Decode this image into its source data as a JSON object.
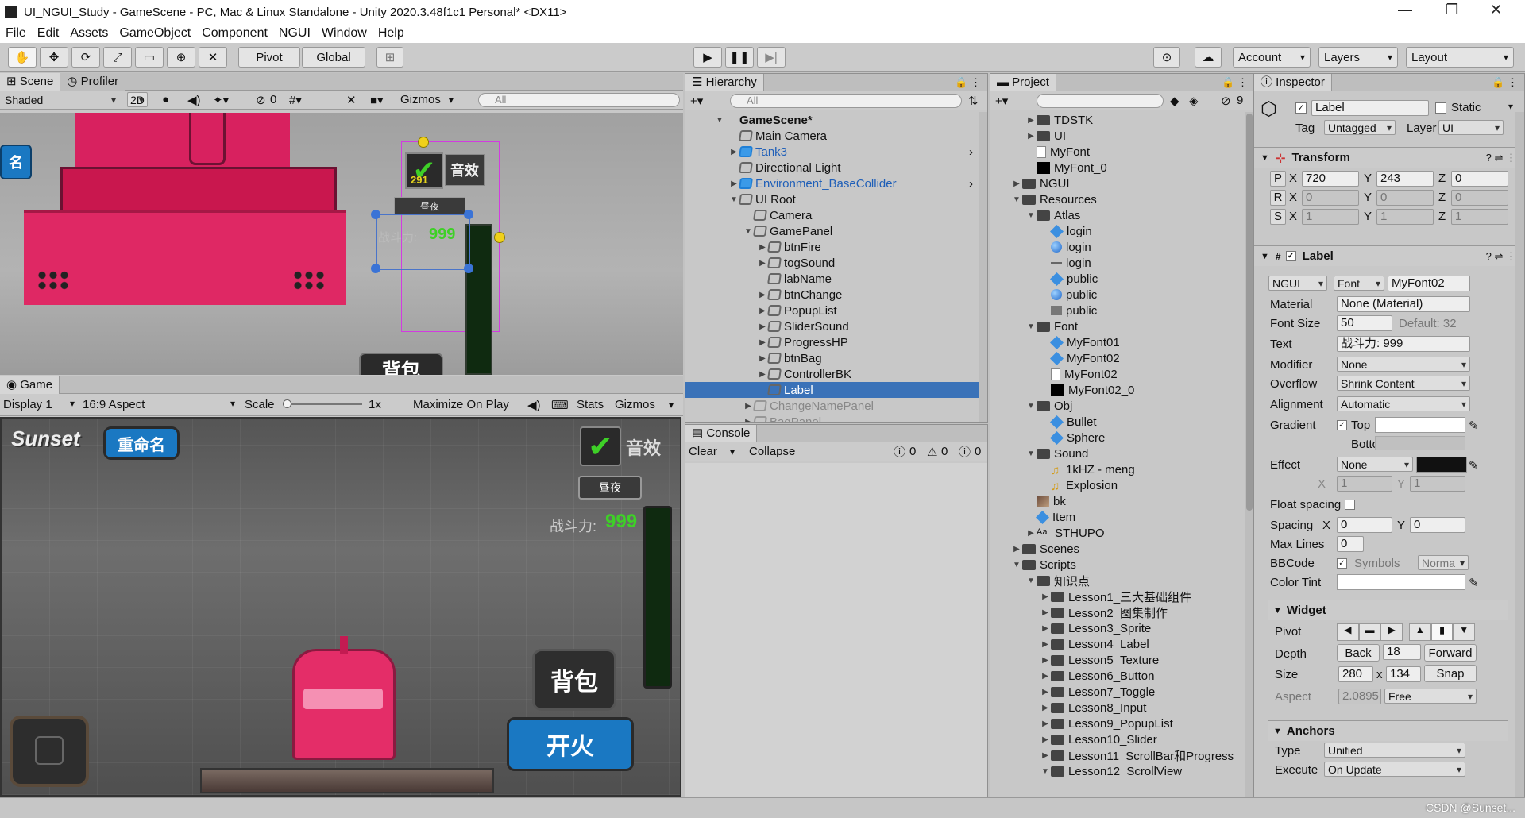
{
  "window": {
    "title": "UI_NGUI_Study - GameScene - PC, Mac & Linux Standalone - Unity 2020.3.48f1c1 Personal* <DX11>",
    "minimize": "—",
    "restore": "❐",
    "close": "✕"
  },
  "menu": [
    "File",
    "Edit",
    "Assets",
    "GameObject",
    "Component",
    "NGUI",
    "Window",
    "Help"
  ],
  "toolbar": {
    "pivot": "Pivot",
    "global": "Global",
    "account": "Account",
    "layers": "Layers",
    "layout": "Layout"
  },
  "scene": {
    "tab": "Scene",
    "profiler_tab": "Profiler",
    "shading": "Shaded",
    "mode2d": "2D",
    "hidden_count": "0",
    "gizmos": "Gizmos",
    "search_placeholder": "All",
    "label_rename": "名",
    "label_sound": "音效",
    "label_daynight": "昼夜",
    "label_power": "战斗力:",
    "power_value": "999",
    "number": "291",
    "label_bag": "背包"
  },
  "game": {
    "tab": "Game",
    "display": "Display 1",
    "aspect": "16:9 Aspect",
    "scale_label": "Scale",
    "scale_value": "1x",
    "maximize": "Maximize On Play",
    "stats": "Stats",
    "gizmos": "Gizmos",
    "logo": "Sunset",
    "rename": "重命名",
    "sound": "音效",
    "daynight": "昼夜",
    "power_label": "战斗力:",
    "power_value": "999",
    "bag": "背包",
    "fire": "开火"
  },
  "hierarchy": {
    "tab": "Hierarchy",
    "search_placeholder": "All",
    "items": [
      {
        "label": "GameScene*",
        "depth": 0,
        "bold": true,
        "arrow": "▼"
      },
      {
        "label": "Main Camera",
        "depth": 1,
        "arrow": ""
      },
      {
        "label": "Tank3",
        "depth": 1,
        "arrow": "▶",
        "blue": true
      },
      {
        "label": "Directional Light",
        "depth": 1,
        "arrow": ""
      },
      {
        "label": "Environment_BaseCollider",
        "depth": 1,
        "arrow": "▶",
        "blue": true
      },
      {
        "label": "UI Root",
        "depth": 1,
        "arrow": "▼"
      },
      {
        "label": "Camera",
        "depth": 2,
        "arrow": ""
      },
      {
        "label": "GamePanel",
        "depth": 2,
        "arrow": "▼"
      },
      {
        "label": "btnFire",
        "depth": 3,
        "arrow": "▶"
      },
      {
        "label": "togSound",
        "depth": 3,
        "arrow": "▶"
      },
      {
        "label": "labName",
        "depth": 3,
        "arrow": ""
      },
      {
        "label": "btnChange",
        "depth": 3,
        "arrow": "▶"
      },
      {
        "label": "PopupList",
        "depth": 3,
        "arrow": "▶"
      },
      {
        "label": "SliderSound",
        "depth": 3,
        "arrow": "▶"
      },
      {
        "label": "ProgressHP",
        "depth": 3,
        "arrow": "▶"
      },
      {
        "label": "btnBag",
        "depth": 3,
        "arrow": "▶"
      },
      {
        "label": "ControllerBK",
        "depth": 3,
        "arrow": "▶"
      },
      {
        "label": "Label",
        "depth": 3,
        "arrow": "",
        "selected": true
      },
      {
        "label": "ChangeNamePanel",
        "depth": 2,
        "arrow": "▶",
        "dim": true
      },
      {
        "label": "BagPanel",
        "depth": 2,
        "arrow": "▶",
        "dim": true
      }
    ]
  },
  "console": {
    "tab": "Console",
    "clear": "Clear",
    "collapse": "Collapse",
    "info": "0",
    "warn": "0",
    "error": "0"
  },
  "project": {
    "tab": "Project",
    "hidden_count": "9",
    "items": [
      {
        "label": "TDSTK",
        "depth": 2,
        "type": "folder",
        "arrow": "▶"
      },
      {
        "label": "UI",
        "depth": 2,
        "type": "folder",
        "arrow": "▶"
      },
      {
        "label": "MyFont",
        "depth": 2,
        "type": "file",
        "arrow": ""
      },
      {
        "label": "MyFont_0",
        "depth": 2,
        "type": "black",
        "arrow": ""
      },
      {
        "label": "NGUI",
        "depth": 1,
        "type": "folder",
        "arrow": "▶"
      },
      {
        "label": "Resources",
        "depth": 1,
        "type": "folder",
        "arrow": "▼"
      },
      {
        "label": "Atlas",
        "depth": 2,
        "type": "folder",
        "arrow": "▼"
      },
      {
        "label": "login",
        "depth": 3,
        "type": "prefab",
        "arrow": ""
      },
      {
        "label": "login",
        "depth": 3,
        "type": "sphere",
        "arrow": ""
      },
      {
        "label": "login",
        "depth": 3,
        "type": "dash",
        "arrow": ""
      },
      {
        "label": "public",
        "depth": 3,
        "type": "prefab",
        "arrow": ""
      },
      {
        "label": "public",
        "depth": 3,
        "type": "sphere",
        "arrow": ""
      },
      {
        "label": "public",
        "depth": 3,
        "type": "gray",
        "arrow": ""
      },
      {
        "label": "Font",
        "depth": 2,
        "type": "folder",
        "arrow": "▼"
      },
      {
        "label": "MyFont01",
        "depth": 3,
        "type": "prefab",
        "arrow": ""
      },
      {
        "label": "MyFont02",
        "depth": 3,
        "type": "prefab",
        "arrow": ""
      },
      {
        "label": "MyFont02",
        "depth": 3,
        "type": "file",
        "arrow": ""
      },
      {
        "label": "MyFont02_0",
        "depth": 3,
        "type": "black",
        "arrow": ""
      },
      {
        "label": "Obj",
        "depth": 2,
        "type": "folder",
        "arrow": "▼"
      },
      {
        "label": "Bullet",
        "depth": 3,
        "type": "prefab",
        "arrow": ""
      },
      {
        "label": "Sphere",
        "depth": 3,
        "type": "prefab",
        "arrow": ""
      },
      {
        "label": "Sound",
        "depth": 2,
        "type": "folder",
        "arrow": "▼"
      },
      {
        "label": "1kHZ - meng",
        "depth": 3,
        "type": "audio",
        "arrow": ""
      },
      {
        "label": "Explosion",
        "depth": 3,
        "type": "audio",
        "arrow": ""
      },
      {
        "label": "bk",
        "depth": 2,
        "type": "image",
        "arrow": ""
      },
      {
        "label": "Item",
        "depth": 2,
        "type": "prefab",
        "arrow": ""
      },
      {
        "label": "STHUPO",
        "depth": 2,
        "type": "fonttext",
        "arrow": "▶"
      },
      {
        "label": "Scenes",
        "depth": 1,
        "type": "folder",
        "arrow": "▶"
      },
      {
        "label": "Scripts",
        "depth": 1,
        "type": "folder",
        "arrow": "▼"
      },
      {
        "label": "知识点",
        "depth": 2,
        "type": "folder",
        "arrow": "▼"
      },
      {
        "label": "Lesson1_三大基础组件",
        "depth": 3,
        "type": "folder",
        "arrow": "▶"
      },
      {
        "label": "Lesson2_图集制作",
        "depth": 3,
        "type": "folder",
        "arrow": "▶"
      },
      {
        "label": "Lesson3_Sprite",
        "depth": 3,
        "type": "folder",
        "arrow": "▶"
      },
      {
        "label": "Lesson4_Label",
        "depth": 3,
        "type": "folder",
        "arrow": "▶"
      },
      {
        "label": "Lesson5_Texture",
        "depth": 3,
        "type": "folder",
        "arrow": "▶"
      },
      {
        "label": "Lesson6_Button",
        "depth": 3,
        "type": "folder",
        "arrow": "▶"
      },
      {
        "label": "Lesson7_Toggle",
        "depth": 3,
        "type": "folder",
        "arrow": "▶"
      },
      {
        "label": "Lesson8_Input",
        "depth": 3,
        "type": "folder",
        "arrow": "▶"
      },
      {
        "label": "Lesson9_PopupList",
        "depth": 3,
        "type": "folder",
        "arrow": "▶"
      },
      {
        "label": "Lesson10_Slider",
        "depth": 3,
        "type": "folder",
        "arrow": "▶"
      },
      {
        "label": "Lesson11_ScrollBar和Progress",
        "depth": 3,
        "type": "folder",
        "arrow": "▶"
      },
      {
        "label": "Lesson12_ScrollView",
        "depth": 3,
        "type": "folder",
        "arrow": "▼"
      }
    ]
  },
  "inspector": {
    "tab": "Inspector",
    "object_name": "Label",
    "static": "Static",
    "tag_label": "Tag",
    "tag": "Untagged",
    "layer_label": "Layer",
    "layer": "UI",
    "transform": {
      "title": "Transform",
      "p": {
        "x": "720",
        "y": "243",
        "z": "0"
      },
      "r": {
        "x": "0",
        "y": "0",
        "z": "0"
      },
      "s": {
        "x": "1",
        "y": "1",
        "z": "1"
      }
    },
    "label_comp": {
      "title": "Label",
      "ngui": "NGUI",
      "font_type": "Font",
      "font": "MyFont02",
      "material_label": "Material",
      "material": "None (Material)",
      "font_size_label": "Font Size",
      "font_size": "50",
      "default_size": "Default: 32",
      "text_label": "Text",
      "text": "战斗力: 999",
      "modifier_label": "Modifier",
      "modifier": "None",
      "overflow_label": "Overflow",
      "overflow": "Shrink Content",
      "alignment_label": "Alignment",
      "alignment": "Automatic",
      "gradient_label": "Gradient",
      "top_label": "Top",
      "bottom_label": "Bottom",
      "effect_label": "Effect",
      "effect": "None",
      "effect_x": "1",
      "effect_y": "1",
      "float_spacing_label": "Float spacing",
      "spacing_label": "Spacing",
      "spacing_x": "0",
      "spacing_y": "0",
      "max_lines_label": "Max Lines",
      "max_lines": "0",
      "bbcode_label": "BBCode",
      "symbols_label": "Symbols",
      "symbols": "Norma",
      "color_tint_label": "Color Tint"
    },
    "widget": {
      "title": "Widget",
      "pivot_label": "Pivot",
      "depth_label": "Depth",
      "back": "Back",
      "depth": "18",
      "forward": "Forward",
      "size_label": "Size",
      "width": "280",
      "height": "134",
      "snap": "Snap",
      "aspect_label": "Aspect",
      "aspect": "2.0895",
      "aspect_mode": "Free"
    },
    "anchors": {
      "title": "Anchors",
      "type_label": "Type",
      "type": "Unified",
      "execute_label": "Execute",
      "execute": "On Update"
    }
  },
  "watermark": "CSDN @Sunset..."
}
